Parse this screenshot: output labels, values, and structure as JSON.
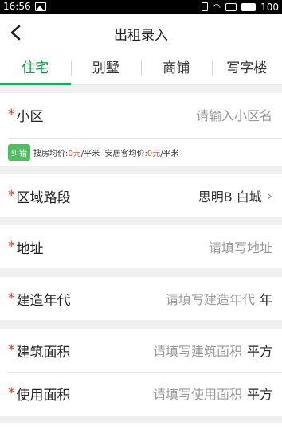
{
  "status_bar": {
    "time": "16:56",
    "battery_text": "100"
  },
  "nav": {
    "title": "出租录入"
  },
  "tabs": [
    {
      "label": "住宅",
      "active": true
    },
    {
      "label": "别墅",
      "active": false
    },
    {
      "label": "商铺",
      "active": false
    },
    {
      "label": "写字楼",
      "active": false
    }
  ],
  "form": {
    "community": {
      "label": "小区",
      "placeholder": "请输入小区名"
    },
    "hint": {
      "correct_label": "纠错",
      "search_avg_prefix": "搜房均价:",
      "search_avg_value": "0元",
      "search_avg_unit": "/平米",
      "anju_avg_prefix": "安居客均价:",
      "anju_avg_value": "0元",
      "anju_avg_unit": "/平米"
    },
    "district": {
      "label": "区域路段",
      "value": "思明B 白城"
    },
    "address": {
      "label": "地址",
      "placeholder": "请填写地址"
    },
    "build_year": {
      "label": "建造年代",
      "placeholder": "请填写建造年代",
      "unit": "年"
    },
    "build_area": {
      "label": "建筑面积",
      "placeholder": "请填写建筑面积",
      "unit": "平方"
    },
    "usable_area": {
      "label": "使用面积",
      "placeholder": "请填写使用面积",
      "unit": "平方"
    }
  },
  "colors": {
    "accent": "#1aa94b",
    "required_star": "#d9302a",
    "correct_btn": "#4cbf5f"
  }
}
